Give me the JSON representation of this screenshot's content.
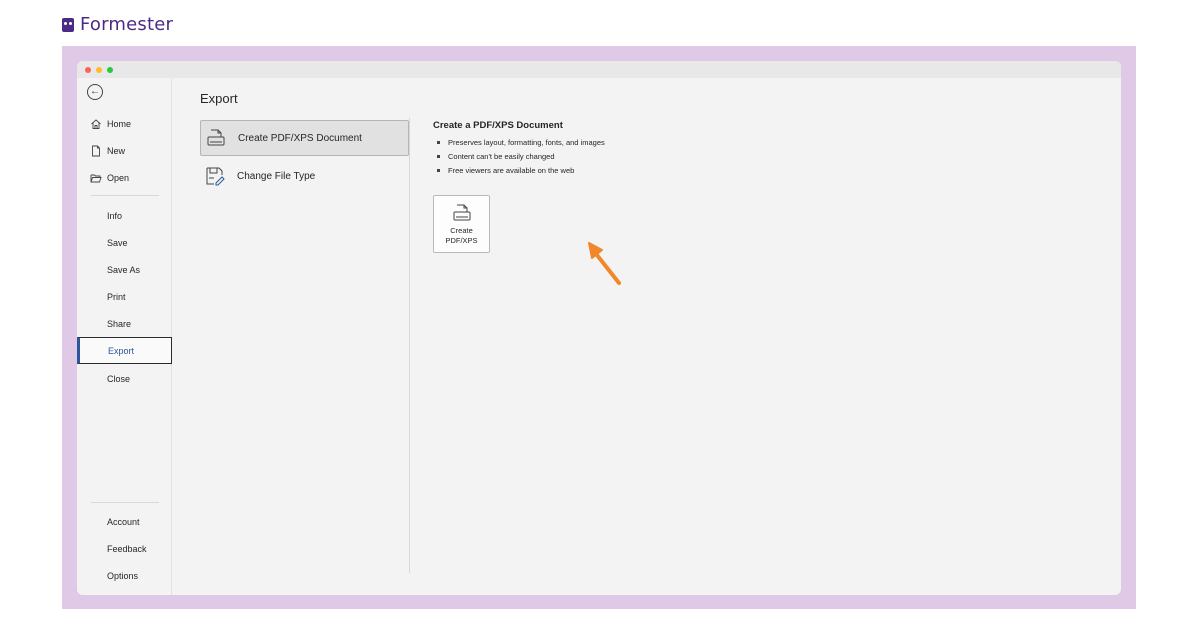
{
  "brand": {
    "name": "Formester",
    "color": "#4b2b86"
  },
  "frame_color": "#dfc9e6",
  "sidebar": {
    "top_items": [
      {
        "label": "Home",
        "icon": "home-icon"
      },
      {
        "label": "New",
        "icon": "new-document-icon"
      },
      {
        "label": "Open",
        "icon": "folder-open-icon"
      }
    ],
    "middle_items": [
      {
        "label": "Info"
      },
      {
        "label": "Save"
      },
      {
        "label": "Save As"
      },
      {
        "label": "Print"
      },
      {
        "label": "Share"
      },
      {
        "label": "Export",
        "active": true
      },
      {
        "label": "Close"
      }
    ],
    "bottom_items": [
      {
        "label": "Account"
      },
      {
        "label": "Feedback"
      },
      {
        "label": "Options"
      }
    ]
  },
  "main": {
    "title": "Export",
    "options": [
      {
        "label": "Create PDF/XPS Document",
        "icon": "pdf-document-icon",
        "selected": true
      },
      {
        "label": "Change File Type",
        "icon": "change-file-type-icon",
        "selected": false
      }
    ],
    "detail": {
      "title": "Create a PDF/XPS Document",
      "bullets": [
        "Preserves layout, formatting, fonts, and images",
        "Content can't be easily changed",
        "Free viewers are available on the web"
      ],
      "button_label": "Create\nPDF/XPS"
    }
  },
  "accent_color": "#2b579a",
  "annotation_arrow_color": "#f0882a"
}
